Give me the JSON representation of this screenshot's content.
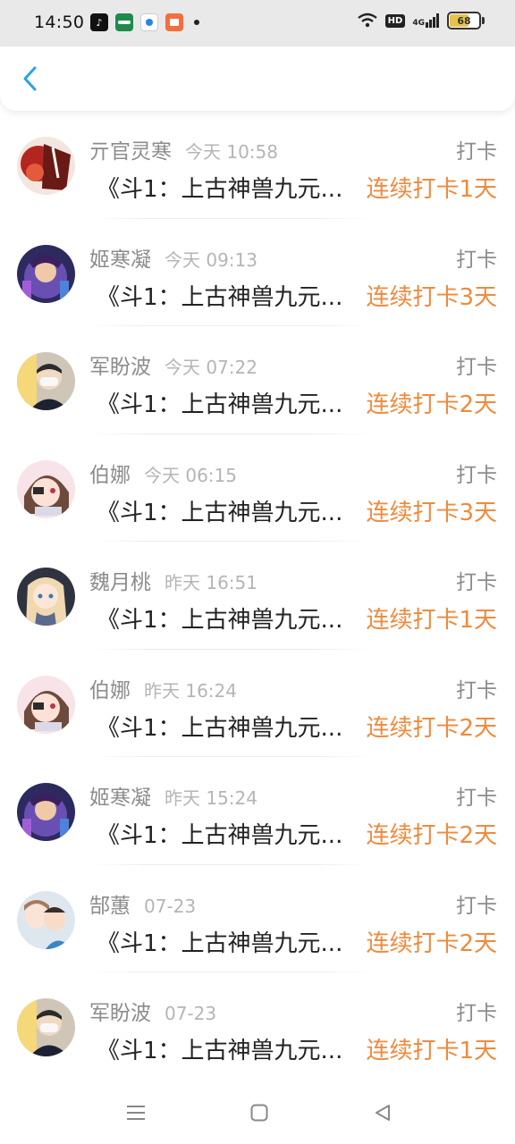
{
  "status_bar": {
    "time": "14:50",
    "battery": "68",
    "battery_level": 0.68,
    "network": "4G",
    "hd": "HD",
    "apps": [
      "tiktok-icon",
      "wechat-pay-icon",
      "camera-icon",
      "reader-icon"
    ]
  },
  "header": {
    "back_icon": "chevron-left-icon",
    "accent_color": "#2aa3e0"
  },
  "items": [
    {
      "name": "亓官灵寒",
      "time": "今天 10:58",
      "action": "打卡",
      "book": "《斗1：上古神兽九元...",
      "streak": "连续打卡1天",
      "avatar": "avatar-red-art"
    },
    {
      "name": "姬寒凝",
      "time": "今天 09:13",
      "action": "打卡",
      "book": "《斗1：上古神兽九元...",
      "streak": "连续打卡3天",
      "avatar": "avatar-purple-art"
    },
    {
      "name": "军盼波",
      "time": "今天 07:22",
      "action": "打卡",
      "book": "《斗1：上古神兽九元...",
      "streak": "连续打卡2天",
      "avatar": "avatar-masked-person"
    },
    {
      "name": "伯娜",
      "time": "今天 06:15",
      "action": "打卡",
      "book": "《斗1：上古神兽九元...",
      "streak": "连续打卡3天",
      "avatar": "avatar-anime-girl"
    },
    {
      "name": "魏月桃",
      "time": "昨天 16:51",
      "action": "打卡",
      "book": "《斗1：上古神兽九元...",
      "streak": "连续打卡1天",
      "avatar": "avatar-anime-blonde"
    },
    {
      "name": "伯娜",
      "time": "昨天 16:24",
      "action": "打卡",
      "book": "《斗1：上古神兽九元...",
      "streak": "连续打卡2天",
      "avatar": "avatar-anime-girl"
    },
    {
      "name": "姬寒凝",
      "time": "昨天 15:24",
      "action": "打卡",
      "book": "《斗1：上古神兽九元...",
      "streak": "连续打卡2天",
      "avatar": "avatar-purple-art"
    },
    {
      "name": "郜蕙",
      "time": "07-23",
      "action": "打卡",
      "book": "《斗1：上古神兽九元...",
      "streak": "连续打卡2天",
      "avatar": "avatar-anime-couple"
    },
    {
      "name": "军盼波",
      "time": "07-23",
      "action": "打卡",
      "book": "《斗1：上古神兽九元...",
      "streak": "连续打卡1天",
      "avatar": "avatar-masked-person"
    }
  ],
  "colors": {
    "name": "#8c8c8c",
    "time": "#b5b5b5",
    "book": "#222222",
    "streak": "#ef8a3c"
  },
  "nav_bar": {
    "icons": [
      "menu-icon",
      "home-square-icon",
      "back-triangle-icon"
    ]
  }
}
